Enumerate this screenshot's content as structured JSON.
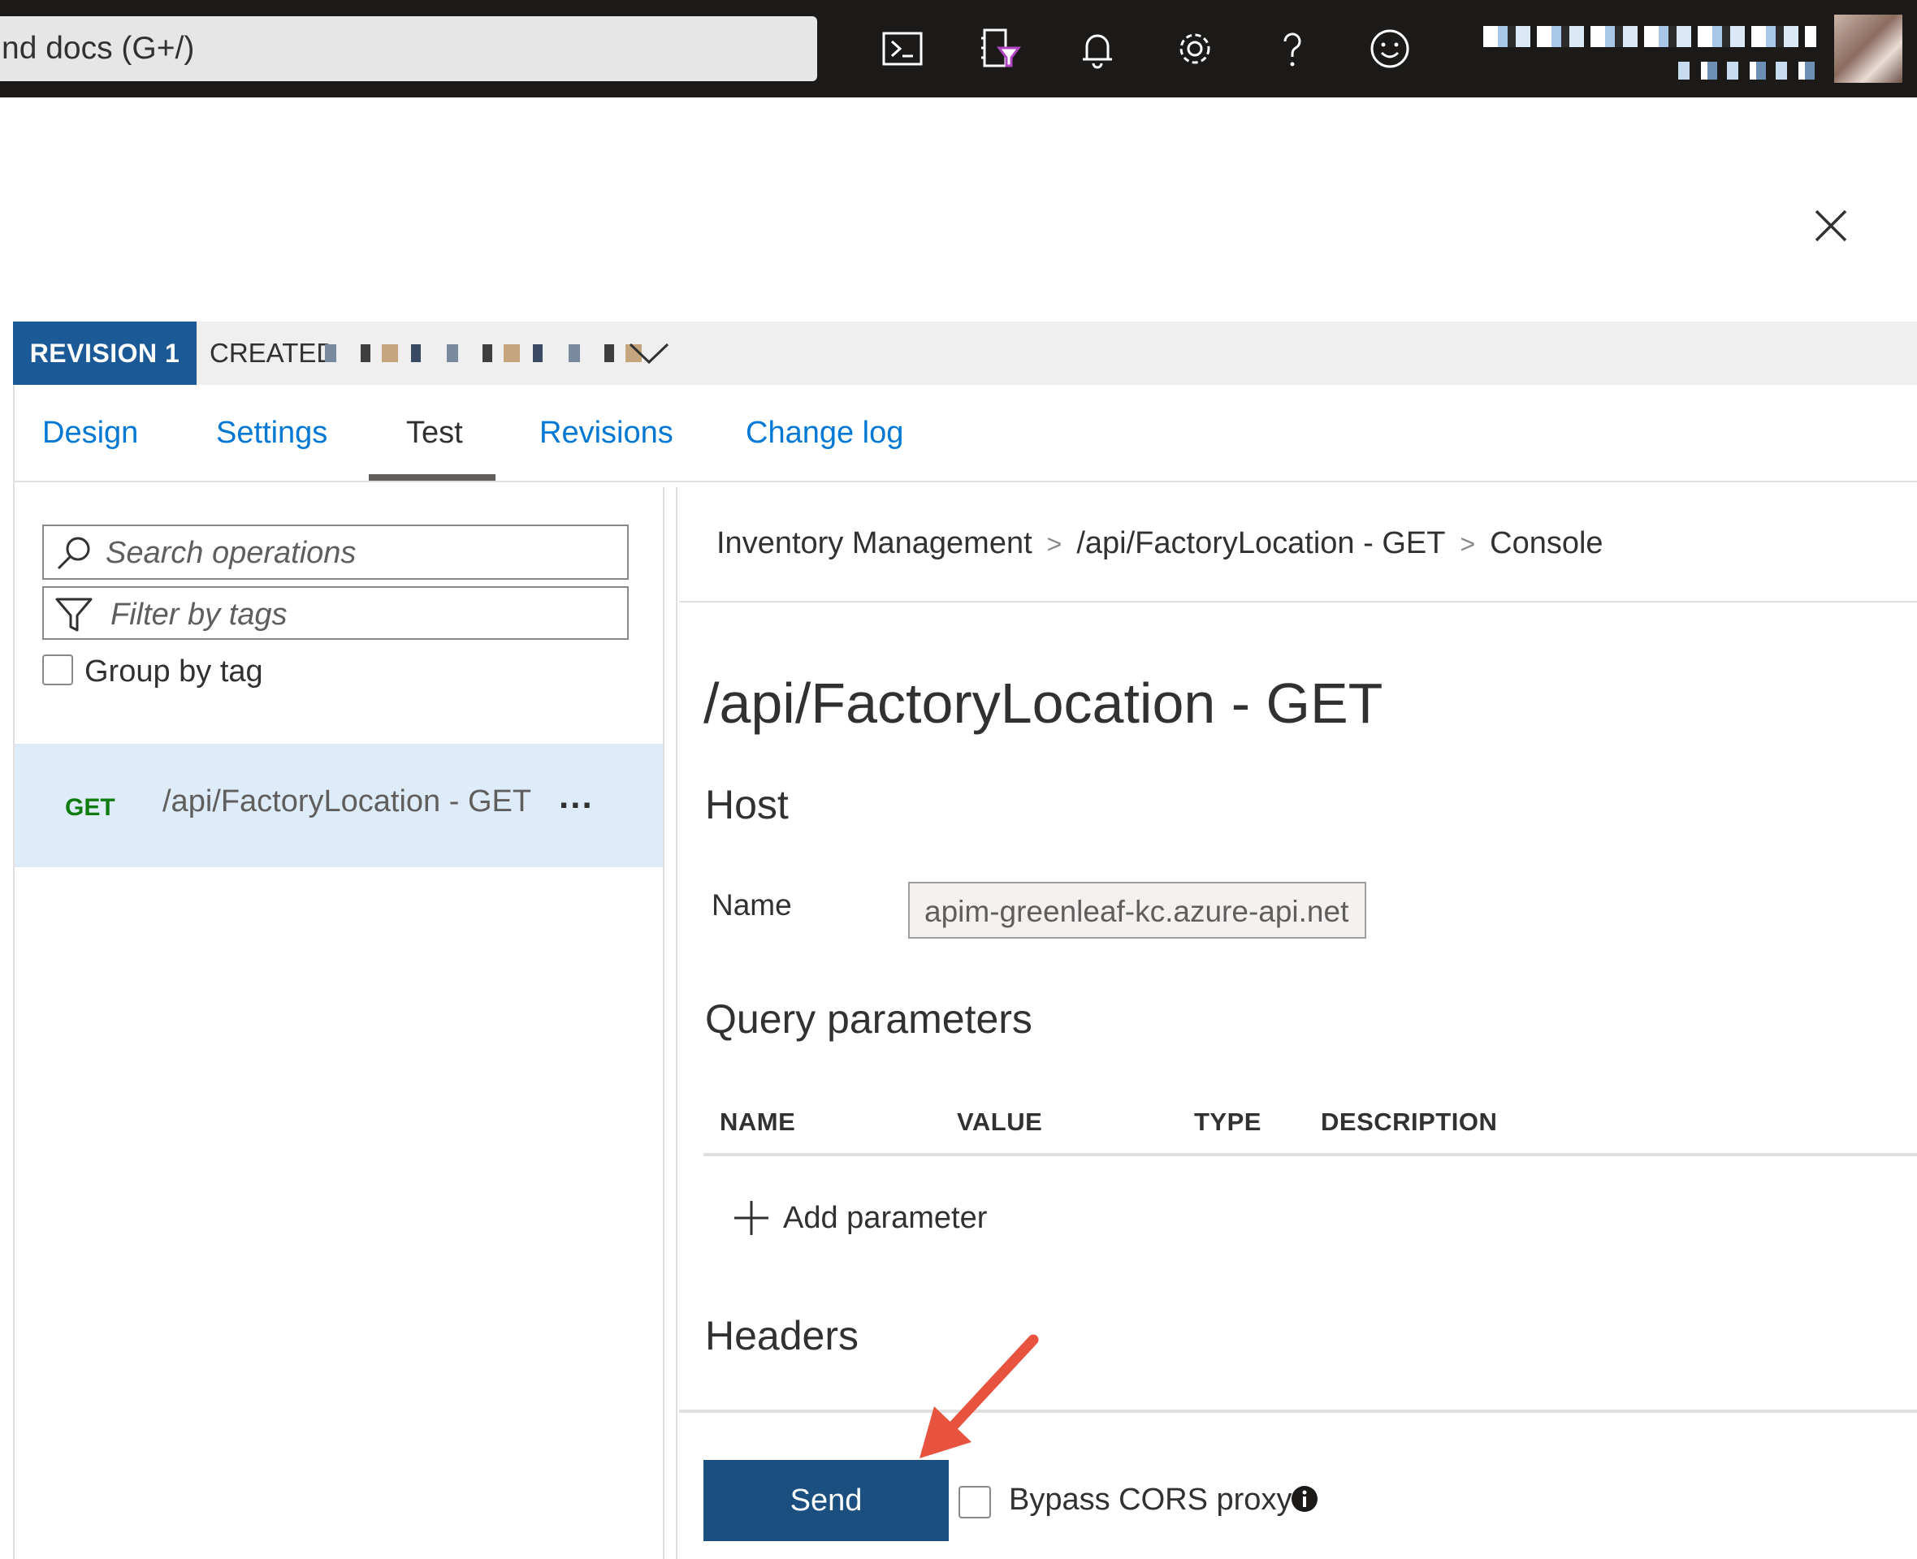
{
  "topbar": {
    "search_text": "nd docs (G+/)",
    "icons": [
      "cloud-shell-icon",
      "directory-filter-icon",
      "notifications-icon",
      "settings-gear-icon",
      "help-icon",
      "feedback-smiley-icon"
    ]
  },
  "revision": {
    "badge": "REVISION 1",
    "created_label": "CREATED"
  },
  "tabs": [
    {
      "label": "Design"
    },
    {
      "label": "Settings"
    },
    {
      "label": "Test"
    },
    {
      "label": "Revisions"
    },
    {
      "label": "Change log"
    }
  ],
  "left": {
    "search_placeholder": "Search operations",
    "filter_placeholder": "Filter by tags",
    "group_by_label": "Group by tag",
    "operations": [
      {
        "method": "GET",
        "name": "/api/FactoryLocation - GET",
        "more": "..."
      }
    ]
  },
  "breadcrumb": {
    "items": [
      "Inventory Management",
      "/api/FactoryLocation - GET",
      "Console"
    ],
    "separator": ">"
  },
  "console": {
    "title": "/api/FactoryLocation - GET",
    "host_heading": "Host",
    "name_label": "Name",
    "host_value": "apim-greenleaf-kc.azure-api.net",
    "query_heading": "Query parameters",
    "columns": [
      "NAME",
      "VALUE",
      "TYPE",
      "DESCRIPTION"
    ],
    "add_parameter": "Add parameter",
    "headers_heading": "Headers",
    "send_label": "Send",
    "bypass_cors_label": "Bypass CORS proxy"
  },
  "colors": {
    "topbar": "#1b1a19",
    "revision_badge": "#1b5a96",
    "link_blue": "#0078d4",
    "selected_row": "#deecf9",
    "get_method": "#107c10",
    "send_button": "#1b4f7f",
    "annotation_arrow": "#e8533f"
  }
}
